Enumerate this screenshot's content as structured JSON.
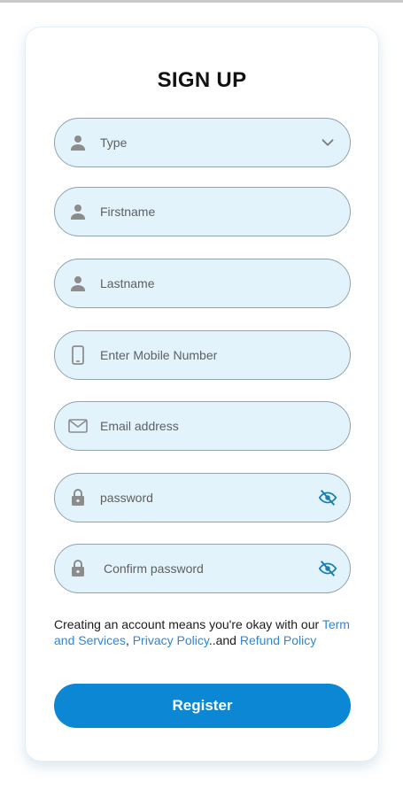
{
  "form": {
    "title": "SIGN UP",
    "fields": [
      {
        "placeholder": "Type",
        "icon": "person-icon",
        "trailing_icon": "chevron-down-icon"
      },
      {
        "placeholder": "Firstname",
        "icon": "person-icon"
      },
      {
        "placeholder": "Lastname",
        "icon": "person-icon"
      },
      {
        "placeholder": "Enter Mobile Number",
        "icon": "phone-icon"
      },
      {
        "placeholder": "Email address",
        "icon": "mail-icon"
      },
      {
        "placeholder": "password",
        "icon": "lock-icon",
        "trailing_icon": "eye-off-icon"
      },
      {
        "placeholder": "Confirm password",
        "icon": "lock-icon",
        "trailing_icon": "eye-off-icon"
      }
    ],
    "terms": {
      "prefix": "Creating an account means you're okay with our ",
      "term_link": "Term and Services",
      "comma": ", ",
      "privacy_link": "Privacy Policy",
      "and_text": "..and ",
      "refund_link": "Refund Policy"
    },
    "register_label": "Register"
  },
  "colors": {
    "field_bg": "#e2f3fc",
    "field_border": "#8ea3ad",
    "icon_gray": "#8c8c8c",
    "eye_icon": "#1a7fb0",
    "link": "#2f86d6",
    "button": "#0b87d3"
  }
}
